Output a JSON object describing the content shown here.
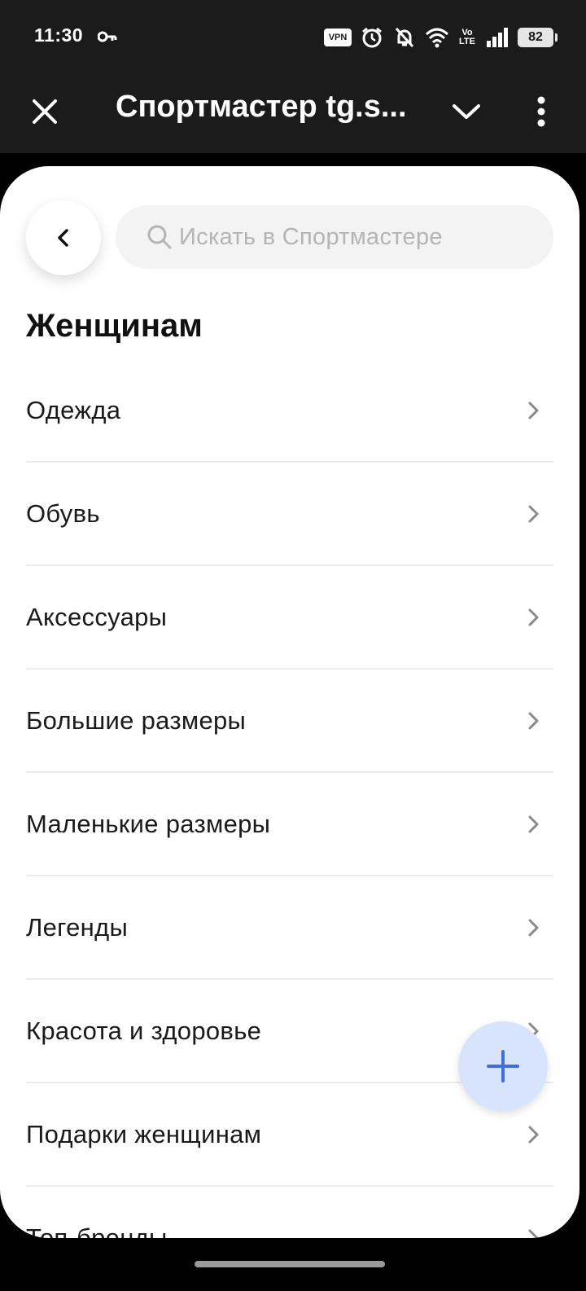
{
  "status_bar": {
    "time": "11:30",
    "vpn": "VPN",
    "volte_top": "Vo",
    "volte_bottom": "LTE",
    "battery": "82"
  },
  "app_bar": {
    "title": "Спортмастер tg.s..."
  },
  "search": {
    "placeholder": "Искать в Спортмастере"
  },
  "page": {
    "title": "Женщинам"
  },
  "categories": [
    {
      "label": "Одежда"
    },
    {
      "label": "Обувь"
    },
    {
      "label": "Аксессуары"
    },
    {
      "label": "Большие размеры"
    },
    {
      "label": "Маленькие размеры"
    },
    {
      "label": "Легенды"
    },
    {
      "label": "Красота и здоровье"
    },
    {
      "label": "Подарки женщинам"
    },
    {
      "label": "Топ-бренды"
    }
  ],
  "colors": {
    "fab_background": "#d8e4fb",
    "fab_icon": "#3f6fd8"
  }
}
